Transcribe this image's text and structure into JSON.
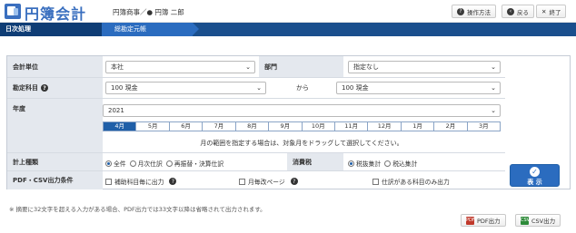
{
  "app": {
    "title": "円簿会計",
    "org": "円簿商事／● 円簿 二郎"
  },
  "header_buttons": {
    "help": "操作方法",
    "back": "戻る",
    "exit": "終了"
  },
  "breadcrumb": {
    "section": "日次処理",
    "page": "総勘定元帳"
  },
  "form": {
    "unit_label": "会計単位",
    "unit_value": "本社",
    "dept_label": "部門",
    "dept_value": "指定なし",
    "account_label": "勘定科目",
    "account_from": "100 現金",
    "from_to_label": "から",
    "account_to": "100 現金",
    "year_label": "年度",
    "year_value": "2021",
    "months": [
      "4月",
      "5月",
      "6月",
      "7月",
      "8月",
      "9月",
      "10月",
      "11月",
      "12月",
      "1月",
      "2月",
      "3月"
    ],
    "selected_month": "4月",
    "month_hint": "月の範囲を指定する場合は、対象月をドラッグして選択してください。",
    "post_type_label": "計上種類",
    "post_types": [
      "全件",
      "月次仕訳",
      "再振替・決算仕訳"
    ],
    "tax_label": "消費税",
    "tax_options": [
      "税抜集計",
      "税込集計"
    ],
    "pdf_label": "PDF・CSV出力条件",
    "pdf_opt1": "補助科目毎に出力",
    "pdf_opt2": "月毎改ページ",
    "pdf_opt3": "仕訳がある科目のみ出力",
    "show_button": "表 示"
  },
  "footer": {
    "note": "※ 摘要に32文字を超える入力がある場合、PDF出力では33文字以降は省略されて出力されます。",
    "pdf_button": "PDF出力",
    "csv_button": "CSV出力"
  }
}
